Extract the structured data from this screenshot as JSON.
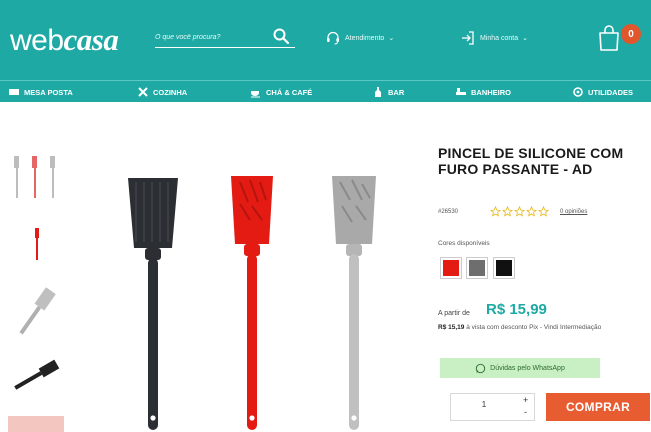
{
  "brand": {
    "name_plain": "web",
    "name_italic": "casa"
  },
  "header": {
    "search_placeholder": "O que você procura?",
    "support_label": "Atendimento",
    "account_label": "Minha conta",
    "cart_count": "0"
  },
  "nav": {
    "items": [
      {
        "label": "MESA POSTA",
        "icon": "table-setting-icon"
      },
      {
        "label": "COZINHA",
        "icon": "crossed-utensils-icon"
      },
      {
        "label": "CHÁ & CAFÉ",
        "icon": "teacup-icon"
      },
      {
        "label": "BAR",
        "icon": "bottle-icon"
      },
      {
        "label": "BANHEIRO",
        "icon": "bath-icon"
      },
      {
        "label": "UTILIDADES",
        "icon": "utilities-icon"
      }
    ]
  },
  "product": {
    "title": "PINCEL DE SILICONE COM FURO PASSANTE - AD",
    "sku": "#26530",
    "rating_stars": 0,
    "reviews_label": "0 opiniões",
    "colors_label": "Cores disponíveis",
    "colors": [
      "#e31b13",
      "#6e6e6e",
      "#111111"
    ],
    "price_prefix": "A partir de",
    "price": "R$ 15,99",
    "pix_price": "R$ 15,19",
    "pix_text": "à vista com desconto Pix - Vindi Intermediação",
    "whatsapp_label": "Dúvidas pelo WhatsApp",
    "quantity": "1",
    "buy_label": "COMPRAR"
  },
  "colors": {
    "primary": "#1ea9a4",
    "buy_button": "#e85c31",
    "cart_badge": "#e2562c",
    "whatsapp_bg": "#c9efc4"
  }
}
